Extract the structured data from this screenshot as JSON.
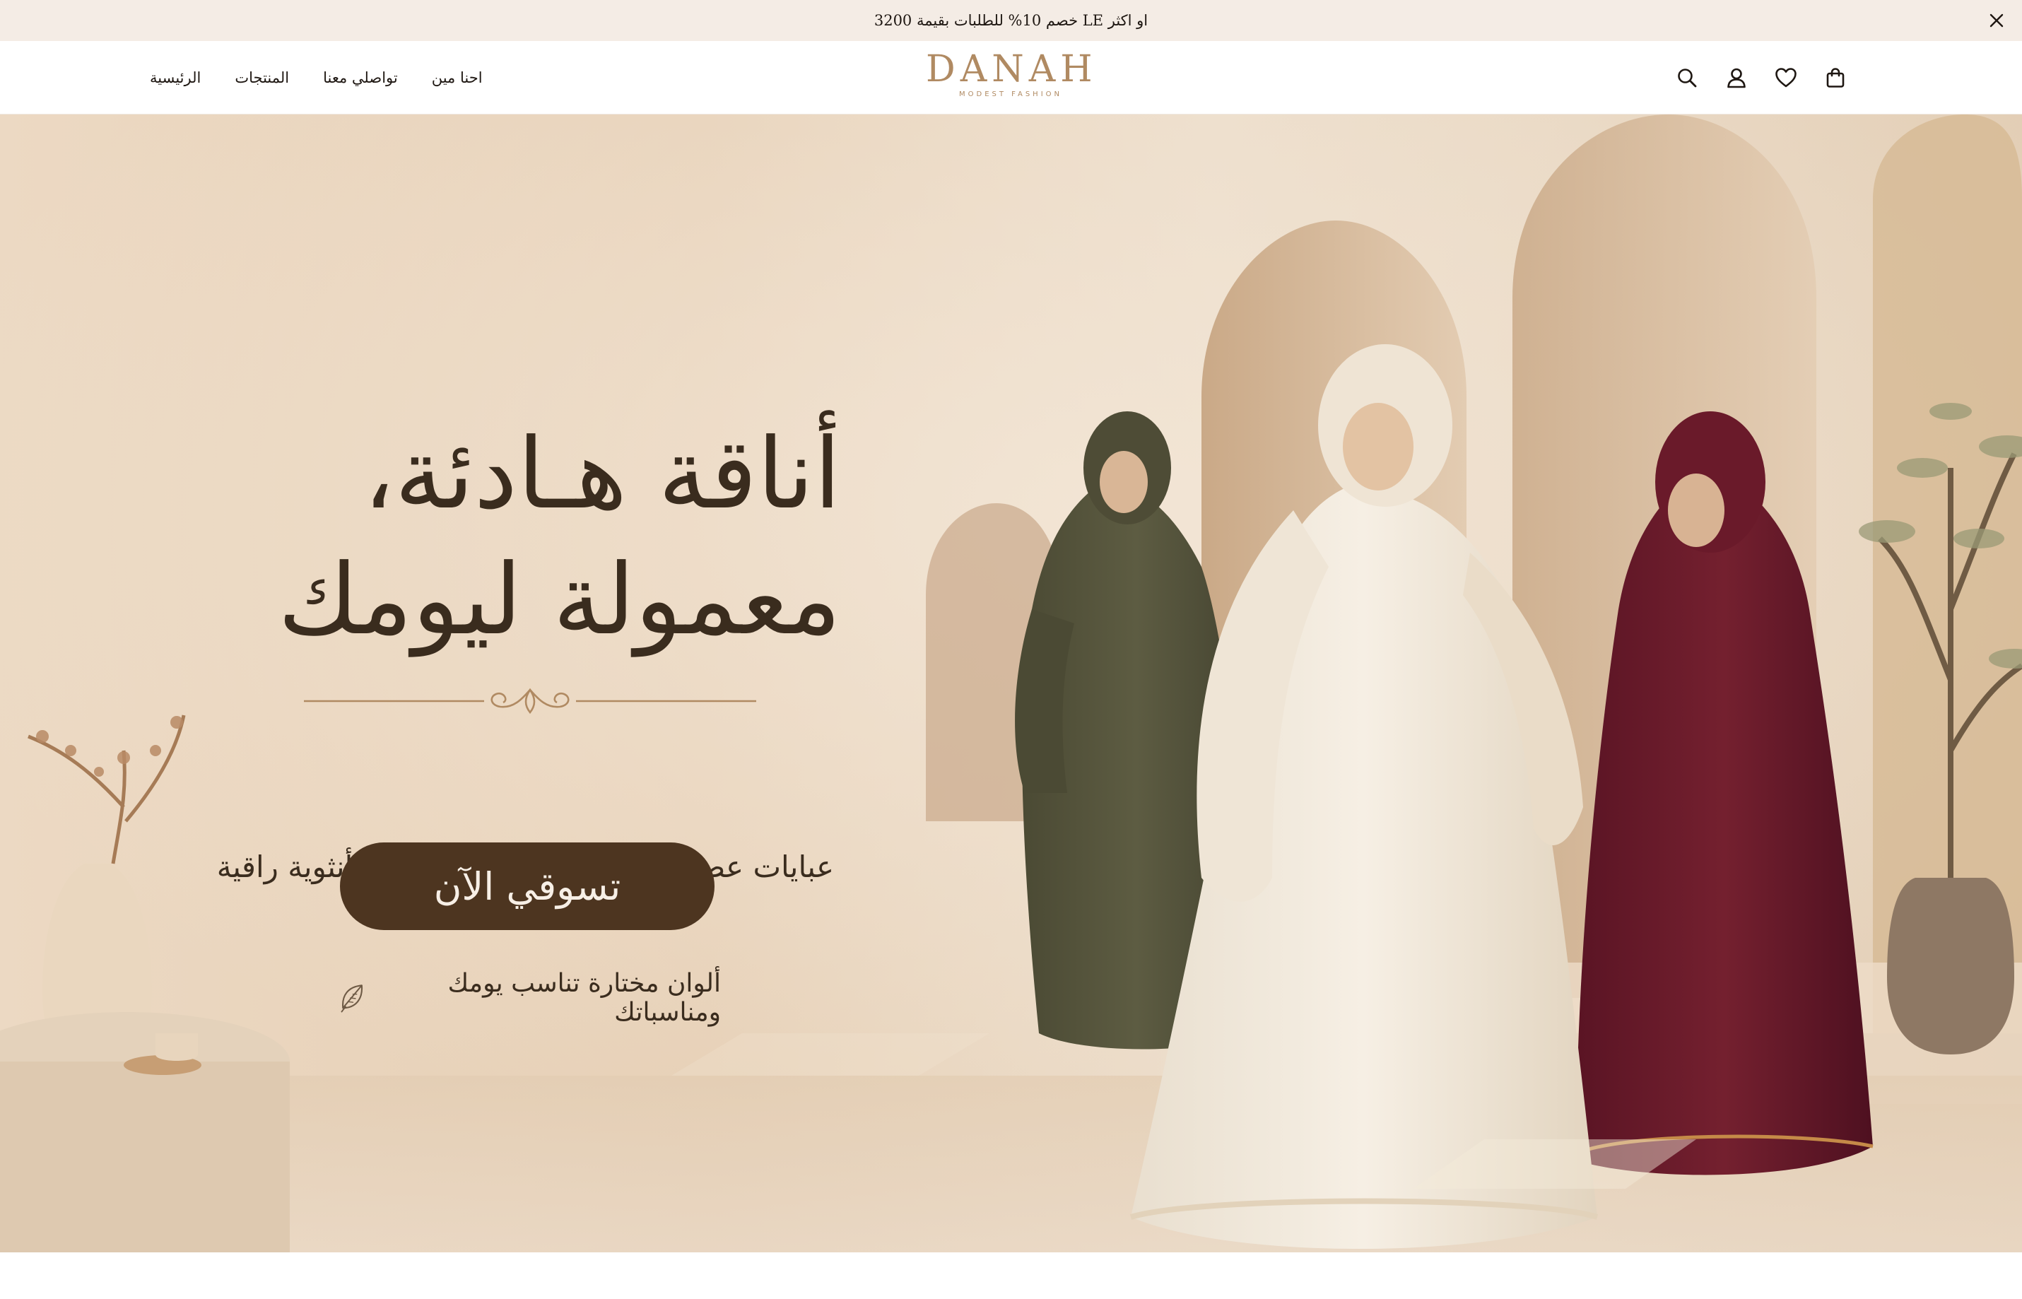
{
  "announcement": {
    "text": "خصم 10% للطلبات بقيمة 3200 LE او اكثر",
    "close_icon": "close-icon"
  },
  "header": {
    "nav": [
      {
        "label": "الرئيسية"
      },
      {
        "label": "المنتجات"
      },
      {
        "label": "تواصلي معنا"
      },
      {
        "label": "احنا مين"
      }
    ],
    "logo": {
      "word": "DANAH",
      "tagline": "MODEST FASHION"
    },
    "icons": [
      "search-icon",
      "account-icon",
      "heart-icon",
      "bag-icon"
    ]
  },
  "hero": {
    "title_line1": "أناقة هـادئة،",
    "title_line2": "معمولة ليومك",
    "subtitle": "عبايات عصرية بخامات مريحة ولمسات أنثوية راقية",
    "cta_label": "تسوقي الآن",
    "note": "ألوان مختارة تناسب يومك ومناسباتك",
    "note_icon": "leaf-icon"
  },
  "colors": {
    "announcement_bg": "#f4ece5",
    "brand": "#b08a62",
    "cta_bg": "#4d3520",
    "hero_text": "#3a2c1e"
  }
}
